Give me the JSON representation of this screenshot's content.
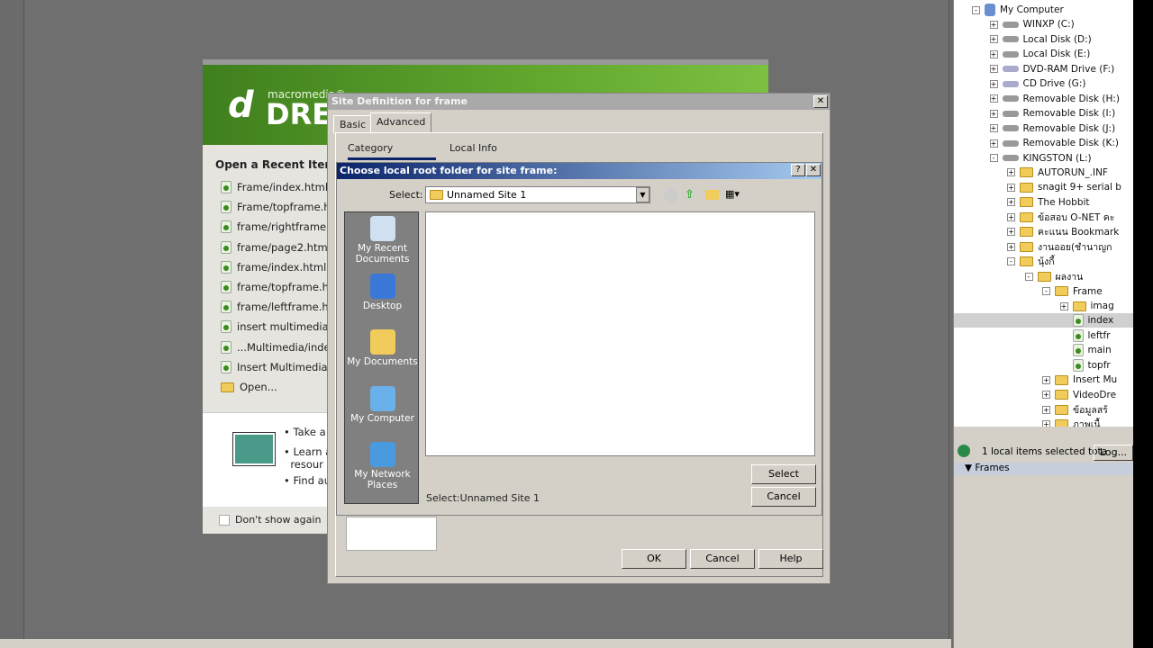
{
  "start_page": {
    "brand_small": "macromedia®",
    "brand_large": "DRE",
    "logo_letter": "d",
    "recent_title": "Open a Recent Item",
    "recent_items": [
      "Frame/index.html",
      "Frame/topframe.ht",
      "frame/rightframe.h",
      "frame/page2.html",
      "frame/index.html",
      "frame/topframe.htr",
      "frame/leftframe.htn",
      "insert multimedia/i",
      "...Multimedia/index",
      "Insert Multimedia/i"
    ],
    "open_label": "Open...",
    "bullets": [
      "Take a",
      "Learn a",
      "resour",
      "Find au"
    ],
    "dont_show": "Don't show again"
  },
  "site_def": {
    "title": "Site Definition for frame",
    "tabs": [
      "Basic",
      "Advanced"
    ],
    "active_tab": "Advanced",
    "columns": [
      "Category",
      "Local Info"
    ],
    "buttons": {
      "ok": "OK",
      "cancel": "Cancel",
      "help": "Help"
    }
  },
  "choose_dialog": {
    "title": "Choose local root folder for site frame:",
    "help": "?",
    "close": "✕",
    "select_label": "Select:",
    "select_value": "Unnamed Site 1",
    "places": [
      "My Recent Documents",
      "Desktop",
      "My Documents",
      "My Computer",
      "My Network Places"
    ],
    "status": "Select:Unnamed Site 1",
    "select_button": "Select",
    "cancel_button": "Cancel"
  },
  "files_panel": {
    "tree": [
      {
        "label": "My Computer",
        "level": 0,
        "toggle": "-",
        "type": "computer"
      },
      {
        "label": "WINXP (C:)",
        "level": 1,
        "toggle": "+",
        "type": "drive"
      },
      {
        "label": "Local Disk (D:)",
        "level": 1,
        "toggle": "+",
        "type": "drive"
      },
      {
        "label": "Local Disk (E:)",
        "level": 1,
        "toggle": "+",
        "type": "drive"
      },
      {
        "label": "DVD-RAM Drive (F:)",
        "level": 1,
        "toggle": "+",
        "type": "cd"
      },
      {
        "label": "CD Drive (G:)",
        "level": 1,
        "toggle": "+",
        "type": "cd"
      },
      {
        "label": "Removable Disk (H:)",
        "level": 1,
        "toggle": "+",
        "type": "drive"
      },
      {
        "label": "Removable Disk (I:)",
        "level": 1,
        "toggle": "+",
        "type": "drive"
      },
      {
        "label": "Removable Disk (J:)",
        "level": 1,
        "toggle": "+",
        "type": "drive"
      },
      {
        "label": "Removable Disk (K:)",
        "level": 1,
        "toggle": "+",
        "type": "drive"
      },
      {
        "label": "KINGSTON (L:)",
        "level": 1,
        "toggle": "-",
        "type": "drive"
      },
      {
        "label": "AUTORUN_.INF",
        "level": 2,
        "toggle": "+",
        "type": "folder"
      },
      {
        "label": "snagit 9+ serial b",
        "level": 2,
        "toggle": "+",
        "type": "folder"
      },
      {
        "label": "The Hobbit",
        "level": 2,
        "toggle": "+",
        "type": "folder"
      },
      {
        "label": "ข้อสอบ O-NET คะ",
        "level": 2,
        "toggle": "+",
        "type": "folder"
      },
      {
        "label": "คะแนน Bookmark",
        "level": 2,
        "toggle": "+",
        "type": "folder"
      },
      {
        "label": "งานออย(ชำนาญก",
        "level": 2,
        "toggle": "+",
        "type": "folder"
      },
      {
        "label": "นุ้งกี้",
        "level": 2,
        "toggle": "-",
        "type": "folder"
      },
      {
        "label": "ผลงาน",
        "level": 3,
        "toggle": "-",
        "type": "folder"
      },
      {
        "label": "Frame",
        "level": 4,
        "toggle": "-",
        "type": "folder"
      },
      {
        "label": "imag",
        "level": 5,
        "toggle": "+",
        "type": "folder"
      },
      {
        "label": "index",
        "level": 5,
        "toggle": "",
        "type": "file",
        "selected": true
      },
      {
        "label": "leftfr",
        "level": 5,
        "toggle": "",
        "type": "file"
      },
      {
        "label": "main",
        "level": 5,
        "toggle": "",
        "type": "file"
      },
      {
        "label": "topfr",
        "level": 5,
        "toggle": "",
        "type": "file"
      },
      {
        "label": "Insert Mu",
        "level": 4,
        "toggle": "+",
        "type": "folder"
      },
      {
        "label": "VideoDre",
        "level": 4,
        "toggle": "+",
        "type": "folder"
      },
      {
        "label": "ข้อมูลสร้",
        "level": 4,
        "toggle": "+",
        "type": "folder"
      },
      {
        "label": "ภาพเนื้",
        "level": 4,
        "toggle": "+",
        "type": "folder"
      }
    ],
    "status": "1 local items selected tota",
    "log_button": "Log...",
    "frames_panel": "▼ Frames"
  }
}
